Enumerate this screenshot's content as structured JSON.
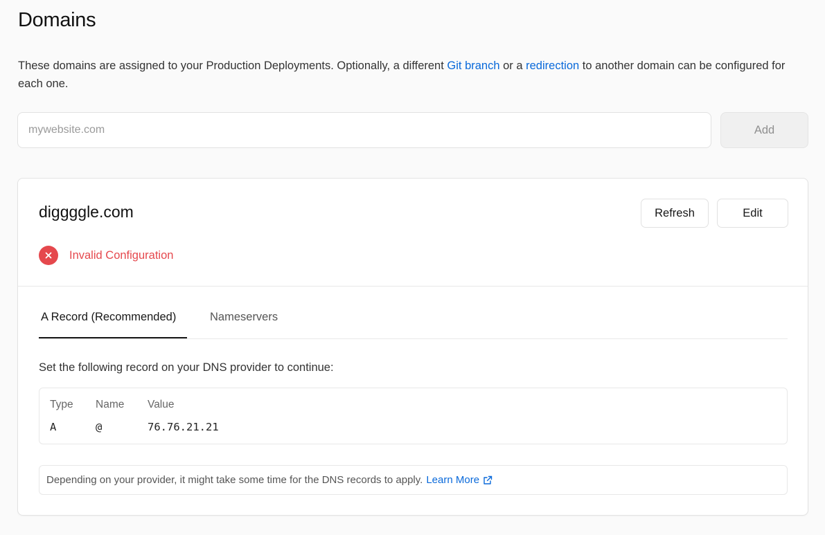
{
  "page": {
    "title": "Domains",
    "description_part1": "These domains are assigned to your Production Deployments. Optionally, a different ",
    "link_git_branch": "Git branch",
    "description_part2": " or a ",
    "link_redirection": "redirection",
    "description_part3": " to another domain can be configured for each one."
  },
  "add_domain": {
    "placeholder": "mywebsite.com",
    "value": "",
    "add_label": "Add"
  },
  "domain_card": {
    "domain": "diggggle.com",
    "refresh_label": "Refresh",
    "edit_label": "Edit",
    "status_text": "Invalid Configuration",
    "status_color": "#e5484d",
    "tabs": [
      {
        "label": "A Record (Recommended)",
        "active": true
      },
      {
        "label": "Nameservers",
        "active": false
      }
    ],
    "instruction": "Set the following record on your DNS provider to continue:",
    "record": {
      "headers": {
        "type": "Type",
        "name": "Name",
        "value": "Value"
      },
      "type": "A",
      "name": "@",
      "value": "76.76.21.21"
    },
    "note_text": "Depending on your provider, it might take some time for the DNS records to apply.",
    "note_link": "Learn More"
  },
  "icons": {
    "status": "x-circle-icon",
    "note_link": "external-link-icon"
  },
  "colors": {
    "link": "#0969da",
    "error": "#e5484d"
  }
}
